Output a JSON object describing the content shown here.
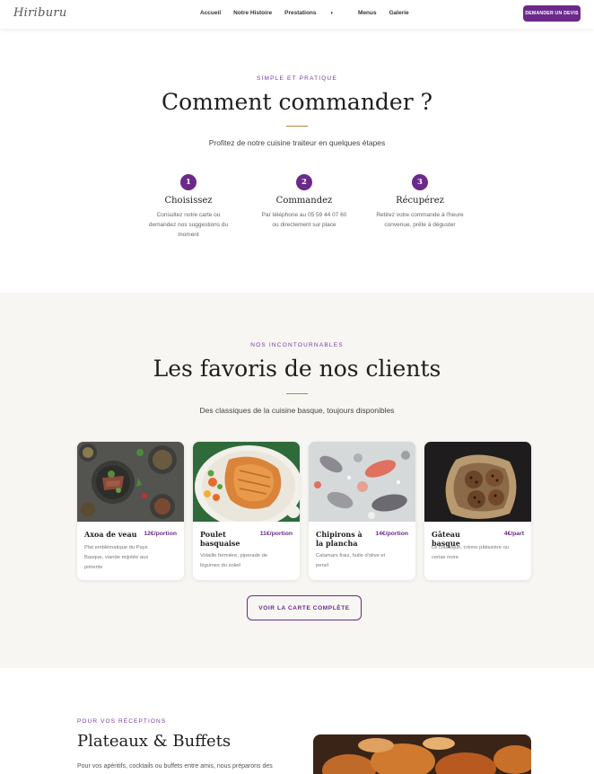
{
  "header": {
    "logo": "Hiriburu",
    "nav": [
      {
        "label": "Accueil"
      },
      {
        "label": "Notre Histoire"
      },
      {
        "label": "Prestations"
      },
      {
        "label": "Menus"
      },
      {
        "label": "Galerie"
      }
    ],
    "cta_label": "DEMANDER UN DEVIS"
  },
  "how": {
    "eyebrow": "SIMPLE ET PRATIQUE",
    "title": "Comment commander ?",
    "subtitle": "Profitez de notre cuisine traiteur en quelques étapes",
    "steps": [
      {
        "number": "1",
        "title": "Choisissez",
        "desc_lines": [
          "Consultez notre carte ou",
          "demandez nos suggestions du",
          "moment"
        ]
      },
      {
        "number": "2",
        "title": "Commandez",
        "desc_lines": [
          "Par téléphone au 05 59 44 07 60",
          "ou directement sur place"
        ]
      },
      {
        "number": "3",
        "title": "Récupérez",
        "desc_lines": [
          "Retirez votre commande à l'heure",
          "convenue, prête à déguster"
        ]
      }
    ]
  },
  "favorites": {
    "eyebrow": "NOS INCONTOURNABLES",
    "title": "Les favoris de nos clients",
    "subtitle": "Des classiques de la cuisine basque, toujours disponibles",
    "cards": [
      {
        "name": "Axoa de veau",
        "price": "12€/portion",
        "desc_lines": [
          "Plat emblématique du Pays",
          "Basque, viande mijotée aux",
          "piments"
        ]
      },
      {
        "name": "Poulet basquaise",
        "price": "11€/portion",
        "desc_lines": [
          "Volaille fermière, piperade de",
          "légumes du soleil"
        ]
      },
      {
        "name": "Chipirons à la plancha",
        "price": "14€/portion",
        "desc_lines": [
          "Calamars frais, huile d'olive et",
          "persil"
        ]
      },
      {
        "name": "Gâteau basque",
        "price": "4€/part",
        "desc_lines": [
          "Le classique, crème pâtissière ou",
          "cerise noire"
        ]
      }
    ],
    "button_label": "VOIR LA CARTE COMPLÈTE"
  },
  "plateaux": {
    "eyebrow": "POUR VOS RÉCEPTIONS",
    "title": "Plateaux & Buffets",
    "paragraph": "Pour vos apéritifs, cocktails ou buffets entre amis, nous préparons des"
  },
  "colors": {
    "accent": "#6b2a8a",
    "gold_rule": "#b08a3a",
    "section_bg": "#f7f6f3"
  }
}
